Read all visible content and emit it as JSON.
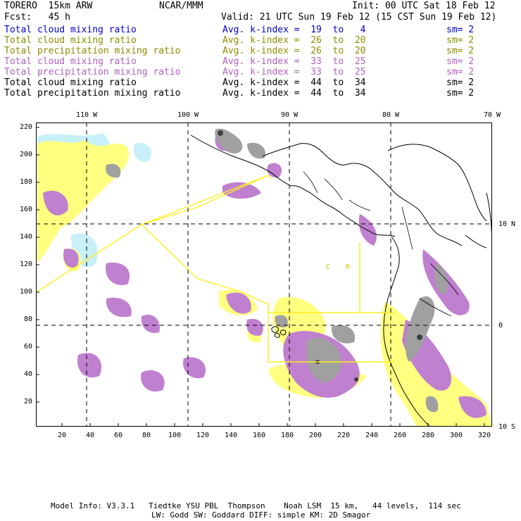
{
  "header": {
    "model": "TORERO  15km ARW",
    "center": "NCAR/MMM",
    "init": "Init: 00 UTC Sat 18 Feb 12",
    "fcst": "Fcst:   45 h",
    "valid": "Valid: 21 UTC Sun 19 Feb 12 (15 CST Sun 19 Feb 12)"
  },
  "legend": [
    {
      "field": "Total cloud mixing ratio",
      "kindex": "Avg. k-index =  19  to   4",
      "sm": "sm= 2",
      "color": "#0000cc"
    },
    {
      "field": "Total cloud mixing ratio",
      "kindex": "Avg. k-index =  26  to  20",
      "sm": "sm= 2",
      "color": "#8c8c00"
    },
    {
      "field": "Total precipitation mixing ratio",
      "kindex": "Avg. k-index =  26  to  20",
      "sm": "sm= 2",
      "color": "#8c8c00"
    },
    {
      "field": "Total cloud mixing ratio",
      "kindex": "Avg. k-index =  33  to  25",
      "sm": "sm= 2",
      "color": "#b060c0"
    },
    {
      "field": "Total precipitation mixing ratio",
      "kindex": "Avg. k-index =  33  to  25",
      "sm": "sm= 2",
      "color": "#b060c0"
    },
    {
      "field": "Total cloud mixing ratio",
      "kindex": "Avg. k-index =  44  to  34",
      "sm": "sm= 2",
      "color": "#000000"
    },
    {
      "field": "Total precipitation mixing ratio",
      "kindex": "Avg. k-index =  44  to  34",
      "sm": "sm= 2",
      "color": "#000000"
    }
  ],
  "axes": {
    "x_ticks": [
      "20",
      "40",
      "60",
      "80",
      "100",
      "120",
      "140",
      "160",
      "180",
      "200",
      "220",
      "240",
      "260",
      "280",
      "300",
      "320"
    ],
    "y_ticks": [
      "220",
      "200",
      "180",
      "160",
      "140",
      "120",
      "100",
      "80",
      "60",
      "40",
      "20"
    ],
    "lon_labels": [
      "110 W",
      "100 W",
      "90 W",
      "80 W",
      "70 W"
    ],
    "lat_labels": [
      "10 N",
      "0",
      "10 S"
    ]
  },
  "map_labels": [
    "C",
    "R"
  ],
  "footer": {
    "line1": "Model Info: V3.3.1   Tiedtke YSU PBL  Thompson    Noah LSM  15 km,   44 levels,  114 sec",
    "line2": "LW: Godd SW: Goddard DIFF: simple KM: 2D Smagor"
  },
  "colors": {
    "cloud_light": "#c8f0f8",
    "yellow": "#ffff80",
    "purple": "#c080d0",
    "gray": "#a0a0a0",
    "dark": "#404040",
    "domain": "#ffee22"
  }
}
